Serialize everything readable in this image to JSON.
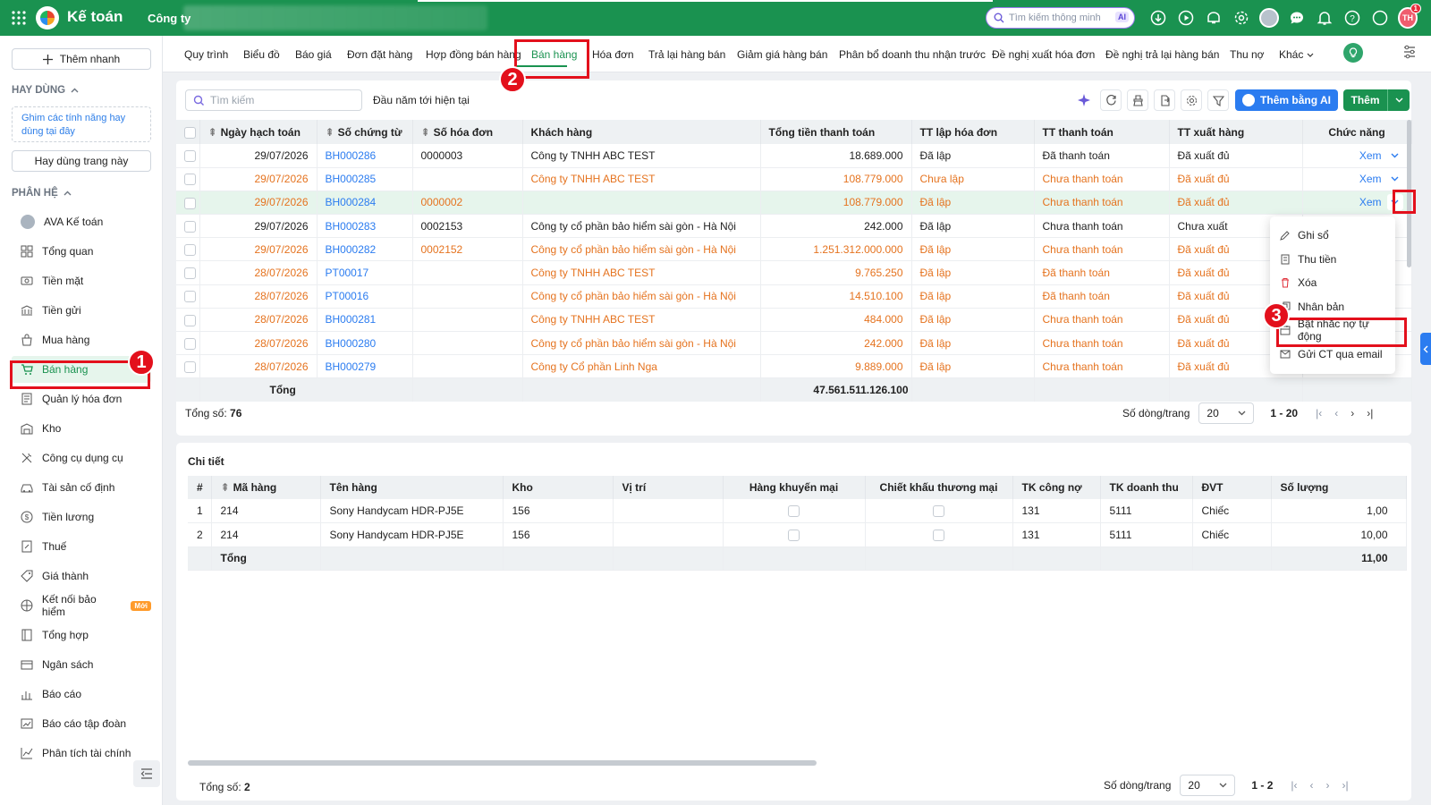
{
  "topbar": {
    "app_title": "Kế toán",
    "company_label": "Công ty",
    "search_placeholder": "Tìm kiếm thông minh",
    "search_ai_badge": "AI",
    "user_initials": "TH",
    "notification_count": "1",
    "brand_color": "#1a9250",
    "icons": [
      "download-icon",
      "play-icon",
      "announce-icon",
      "gear-icon",
      "avatar",
      "chat-icon",
      "bell-icon",
      "help-icon",
      "smile-icon"
    ]
  },
  "sidebar": {
    "quick_add": "Thêm nhanh",
    "favorites_title": "HAY DÙNG",
    "pin_hint": "Ghim các tính năng hay dùng tại đây",
    "use_page": "Hay dùng trang này",
    "modules_title": "PHÂN HỆ",
    "items": [
      {
        "label": "AVA Kế toán",
        "icon": "ava-icon"
      },
      {
        "label": "Tổng quan",
        "icon": "dashboard-icon"
      },
      {
        "label": "Tiền mặt",
        "icon": "cash-icon"
      },
      {
        "label": "Tiền gửi",
        "icon": "bank-icon"
      },
      {
        "label": "Mua hàng",
        "icon": "bag-icon"
      },
      {
        "label": "Bán hàng",
        "icon": "cart-icon",
        "active": true
      },
      {
        "label": "Quản lý hóa đơn",
        "icon": "invoice-icon"
      },
      {
        "label": "Kho",
        "icon": "warehouse-icon"
      },
      {
        "label": "Công cụ dụng cụ",
        "icon": "tools-icon"
      },
      {
        "label": "Tài sản cố định",
        "icon": "car-icon"
      },
      {
        "label": "Tiền lương",
        "icon": "salary-icon"
      },
      {
        "label": "Thuế",
        "icon": "tax-icon"
      },
      {
        "label": "Giá thành",
        "icon": "tag-icon"
      },
      {
        "label": "Kết nối bảo hiểm",
        "icon": "shield-icon",
        "badge": "Mới"
      },
      {
        "label": "Tổng hợp",
        "icon": "book-icon"
      },
      {
        "label": "Ngân sách",
        "icon": "budget-icon"
      },
      {
        "label": "Báo cáo",
        "icon": "chart-icon"
      },
      {
        "label": "Báo cáo tập đoàn",
        "icon": "group-report-icon"
      },
      {
        "label": "Phân tích tài chính",
        "icon": "analysis-icon"
      }
    ]
  },
  "tabs": [
    "Quy trình",
    "Biểu đồ",
    "Báo giá",
    "Đơn đặt hàng",
    "Hợp đồng bán hàng",
    "Bán hàng",
    "Hóa đơn",
    "Trả lại hàng bán",
    "Giảm giá hàng bán",
    "Phân bổ doanh thu nhận trước",
    "Đề nghị xuất hóa đơn",
    "Đề nghị trả lại hàng bán",
    "Thu nợ",
    "Khác"
  ],
  "active_tab": "Bán hàng",
  "list": {
    "search_placeholder": "Tìm kiếm",
    "period": "Đầu năm tới hiện tại",
    "add_ai": "Thêm bằng AI",
    "add": "Thêm",
    "columns": [
      "Ngày hạch toán",
      "Số chứng từ",
      "Số hóa đơn",
      "Khách hàng",
      "Tổng tiền thanh toán",
      "TT lập hóa đơn",
      "TT thanh toán",
      "TT xuất hàng",
      "Chức năng"
    ],
    "rows": [
      {
        "date": "29/07/2026",
        "doc": "BH000286",
        "invoice": "0000003",
        "customer": "Công ty TNHH ABC TEST",
        "total": "18.689.000",
        "inv_status": "Đã lập",
        "pay_status": "Đã thanh toán",
        "ship_status": "Đã xuất đủ",
        "action": "Xem",
        "style": "normal"
      },
      {
        "date": "29/07/2026",
        "doc": "BH000285",
        "invoice": "",
        "customer": "Công ty TNHH ABC TEST",
        "total": "108.779.000",
        "inv_status": "Chưa lập",
        "pay_status": "Chưa thanh toán",
        "ship_status": "Đã xuất đủ",
        "action": "Xem",
        "style": "orange"
      },
      {
        "date": "29/07/2026",
        "doc": "BH000284",
        "invoice": "0000002",
        "customer": "",
        "total": "108.779.000",
        "inv_status": "Đã lập",
        "pay_status": "Chưa thanh toán",
        "ship_status": "Đã xuất đủ",
        "action": "Xem",
        "style": "orange sel"
      },
      {
        "date": "29/07/2026",
        "doc": "BH000283",
        "invoice": "0002153",
        "customer": "Công ty cổ phần bảo hiểm sài gòn - Hà Nội",
        "total": "242.000",
        "inv_status": "Đã lập",
        "pay_status": "Chưa thanh toán",
        "ship_status": "Chưa xuất",
        "action": "",
        "style": "normal"
      },
      {
        "date": "29/07/2026",
        "doc": "BH000282",
        "invoice": "0002152",
        "customer": "Công ty cổ phần bảo hiểm sài gòn - Hà Nội",
        "total": "1.251.312.000.000",
        "inv_status": "Đã lập",
        "pay_status": "Chưa thanh toán",
        "ship_status": "Đã xuất đủ",
        "action": "",
        "style": "orange"
      },
      {
        "date": "28/07/2026",
        "doc": "PT00017",
        "invoice": "",
        "customer": "Công ty TNHH ABC TEST",
        "total": "9.765.250",
        "inv_status": "Đã lập",
        "pay_status": "Đã thanh toán",
        "ship_status": "Đã xuất đủ",
        "action": "",
        "style": "orange"
      },
      {
        "date": "28/07/2026",
        "doc": "PT00016",
        "invoice": "",
        "customer": "Công ty cổ phần bảo hiểm sài gòn - Hà Nội",
        "total": "14.510.100",
        "inv_status": "Đã lập",
        "pay_status": "Đã thanh toán",
        "ship_status": "Đã xuất đủ",
        "action": "",
        "style": "orange"
      },
      {
        "date": "28/07/2026",
        "doc": "BH000281",
        "invoice": "",
        "customer": "Công ty TNHH ABC TEST",
        "total": "484.000",
        "inv_status": "Đã lập",
        "pay_status": "Chưa thanh toán",
        "ship_status": "Đã xuất đủ",
        "action": "",
        "style": "orange"
      },
      {
        "date": "28/07/2026",
        "doc": "BH000280",
        "invoice": "",
        "customer": "Công ty cổ phần bảo hiểm sài gòn - Hà Nội",
        "total": "242.000",
        "inv_status": "Đã lập",
        "pay_status": "Chưa thanh toán",
        "ship_status": "Đã xuất đủ",
        "action": "",
        "style": "orange"
      },
      {
        "date": "28/07/2026",
        "doc": "BH000279",
        "invoice": "",
        "customer": "Công ty Cổ phần Linh Nga",
        "total": "9.889.000",
        "inv_status": "Đã lập",
        "pay_status": "Chưa thanh toán",
        "ship_status": "Đã xuất đủ",
        "action": "",
        "style": "orange"
      }
    ],
    "total_label": "Tổng",
    "total_value": "47.561.511.126.100",
    "count_label": "Tổng số:",
    "count": "76",
    "rows_per_page_label": "Số dòng/trang",
    "rows_per_page": "20",
    "range": "1 - 20"
  },
  "menu": {
    "items": [
      {
        "label": "Ghi sổ",
        "icon": "pencil-icon"
      },
      {
        "label": "Thu tiền",
        "icon": "receipt-icon"
      },
      {
        "label": "Xóa",
        "icon": "trash-icon"
      },
      {
        "label": "Nhân bản",
        "icon": "copy-icon"
      },
      {
        "label": "Bật nhắc nợ tự động",
        "icon": "calendar-icon"
      },
      {
        "label": "Gửi CT qua email",
        "icon": "mail-icon"
      }
    ]
  },
  "detail": {
    "title": "Chi tiết",
    "columns": [
      "#",
      "Mã hàng",
      "Tên hàng",
      "Kho",
      "Vị trí",
      "Hàng khuyến mại",
      "Chiết khấu thương mại",
      "TK công nợ",
      "TK doanh thu",
      "ĐVT",
      "Số lượng"
    ],
    "rows": [
      {
        "no": "1",
        "code": "214",
        "name": "Sony Handycam HDR-PJ5E",
        "warehouse": "156",
        "location": "",
        "promo": false,
        "discount": false,
        "ar_account": "131",
        "rev_account": "5111",
        "unit": "Chiếc",
        "qty": "1,00"
      },
      {
        "no": "2",
        "code": "214",
        "name": "Sony Handycam HDR-PJ5E",
        "warehouse": "156",
        "location": "",
        "promo": false,
        "discount": false,
        "ar_account": "131",
        "rev_account": "5111",
        "unit": "Chiếc",
        "qty": "10,00"
      }
    ],
    "total_label": "Tổng",
    "total_qty": "11,00",
    "count_label": "Tổng số:",
    "count": "2",
    "rows_per_page_label": "Số dòng/trang",
    "rows_per_page": "20",
    "range": "1 - 2"
  },
  "annotations": [
    "1",
    "2",
    "3"
  ]
}
